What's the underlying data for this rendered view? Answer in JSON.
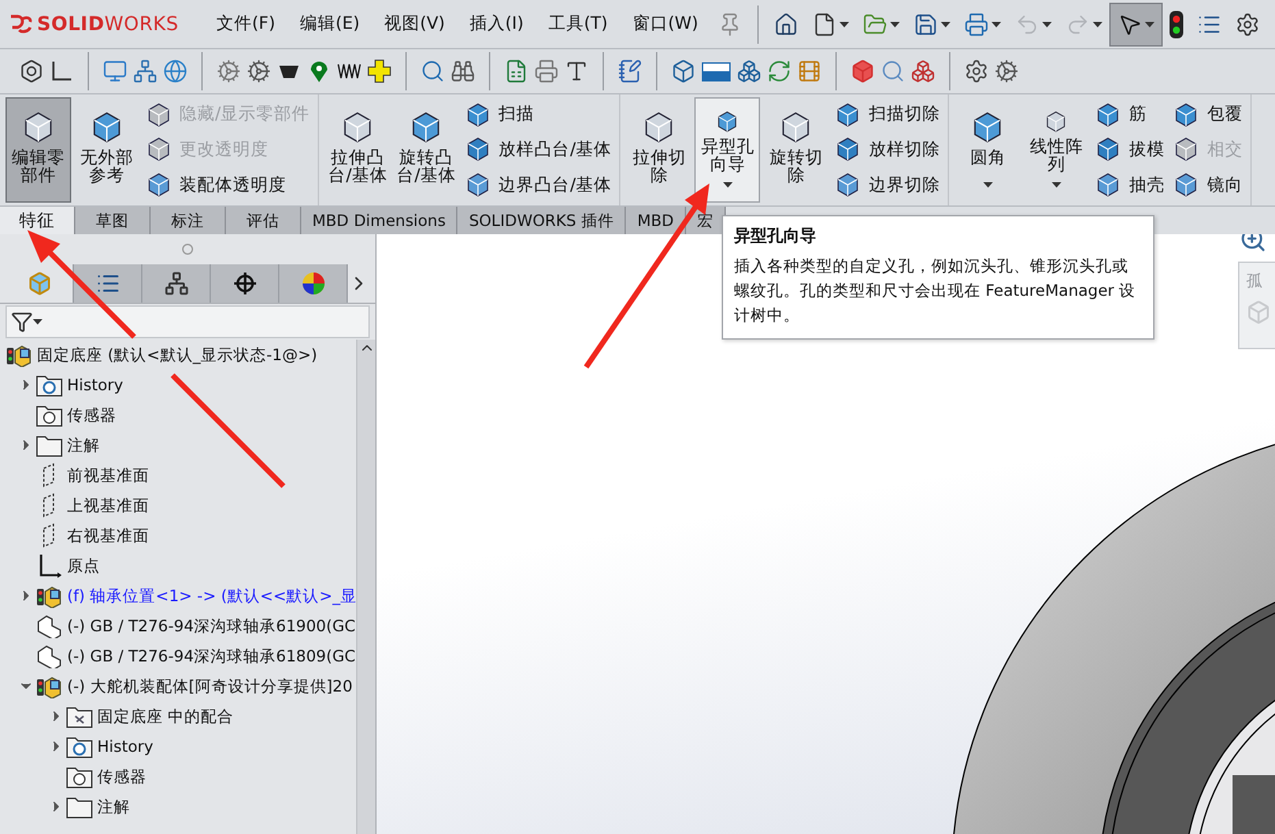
{
  "app": {
    "logo": "**SOLID**WORKS"
  },
  "menu": [
    "文件(F)",
    "编辑(E)",
    "视图(V)",
    "插入(I)",
    "工具(T)",
    "窗口(W)"
  ],
  "ribbon": {
    "groups": [
      {
        "large": [
          {
            "label": "编辑零部件",
            "pressed": true,
            "highlighted": false,
            "dropdown": false
          },
          {
            "label": "无外部参考",
            "pressed": false,
            "highlighted": false,
            "dropdown": false
          }
        ],
        "columns": [
          [
            {
              "label": "隐藏/显示零部件",
              "disabled": true
            },
            {
              "label": "更改透明度",
              "disabled": true
            },
            {
              "label": "装配体透明度",
              "disabled": false
            }
          ]
        ]
      },
      {
        "large": [
          {
            "label": "拉伸凸台/基体",
            "pressed": false,
            "highlighted": false,
            "dropdown": false
          },
          {
            "label": "旋转凸台/基体",
            "pressed": false,
            "highlighted": false,
            "dropdown": false
          }
        ],
        "columns": [
          [
            {
              "label": "扫描",
              "disabled": false
            },
            {
              "label": "放样凸台/基体",
              "disabled": false
            },
            {
              "label": "边界凸台/基体",
              "disabled": false
            }
          ]
        ]
      },
      {
        "large": [
          {
            "label": "拉伸切除",
            "pressed": false,
            "highlighted": false,
            "dropdown": false
          },
          {
            "label": "异型孔向导",
            "pressed": false,
            "highlighted": true,
            "dropdown": true
          },
          {
            "label": "旋转切除",
            "pressed": false,
            "highlighted": false,
            "dropdown": false
          }
        ],
        "columns": [
          [
            {
              "label": "扫描切除",
              "disabled": false
            },
            {
              "label": "放样切除",
              "disabled": false
            },
            {
              "label": "边界切除",
              "disabled": false
            }
          ]
        ]
      },
      {
        "large": [
          {
            "label": "圆角",
            "pressed": false,
            "highlighted": false,
            "dropdown": true
          },
          {
            "label": "线性阵列",
            "pressed": false,
            "highlighted": false,
            "dropdown": true
          }
        ],
        "columns": [
          [
            {
              "label": "筋",
              "disabled": false
            },
            {
              "label": "拔模",
              "disabled": false
            },
            {
              "label": "抽壳",
              "disabled": false
            }
          ],
          [
            {
              "label": "包覆",
              "disabled": false
            },
            {
              "label": "相交",
              "disabled": true
            },
            {
              "label": "镜向",
              "disabled": false
            }
          ]
        ]
      }
    ]
  },
  "tabs": [
    {
      "label": "特征",
      "selected": true
    },
    {
      "label": "草图",
      "selected": false
    },
    {
      "label": "标注",
      "selected": false
    },
    {
      "label": "评估",
      "selected": false
    },
    {
      "label": "MBD Dimensions",
      "selected": false
    },
    {
      "label": "SOLIDWORKS 插件",
      "selected": false
    },
    {
      "label": "MBD",
      "selected": false
    },
    {
      "label": "宏",
      "selected": false
    }
  ],
  "tooltip": {
    "title": "异型孔向导",
    "text": "插入各种类型的自定义孔，例如沉头孔、锥形沉头孔或螺纹孔。孔的类型和尺寸会出现在 FeatureManager 设计树中。"
  },
  "panel_tabs": [
    {
      "kind": "feature",
      "selected": true
    },
    {
      "kind": "property",
      "selected": false
    },
    {
      "kind": "config",
      "selected": false
    },
    {
      "kind": "dimxpert",
      "selected": false
    },
    {
      "kind": "display",
      "selected": false
    }
  ],
  "tree": [
    {
      "kind": "assembly",
      "label": "固定底座  (默认<默认_显示状态-1@>)",
      "children": [
        {
          "kind": "history",
          "label": "History",
          "expanded": false
        },
        {
          "kind": "sensor",
          "label": "传感器"
        },
        {
          "kind": "annotation",
          "label": "注解",
          "expanded": false
        },
        {
          "kind": "plane",
          "label": "前视基准面"
        },
        {
          "kind": "plane",
          "label": "上视基准面"
        },
        {
          "kind": "plane",
          "label": "右视基准面"
        },
        {
          "kind": "origin",
          "label": "原点"
        },
        {
          "kind": "assembly",
          "label": "(f) 轴承位置<1> -> (默认<<默认>_显",
          "expanded": false,
          "color": "#1a1aff"
        },
        {
          "kind": "part",
          "label": "(-) GB / T276-94深沟球轴承61900(GC"
        },
        {
          "kind": "part",
          "label": "(-) GB / T276-94深沟球轴承61809(GC"
        },
        {
          "kind": "assembly",
          "label": "(-) 大舵机装配体[阿奇设计分享提供]20",
          "expanded": true,
          "children": [
            {
              "kind": "mates",
              "label": "固定底座 中的配合",
              "expanded": false
            },
            {
              "kind": "history",
              "label": "History",
              "expanded": false
            },
            {
              "kind": "sensor",
              "label": "传感器"
            },
            {
              "kind": "annotation",
              "label": "注解",
              "expanded": false
            }
          ]
        }
      ]
    }
  ],
  "viewport": {
    "side_panel": "孤"
  }
}
